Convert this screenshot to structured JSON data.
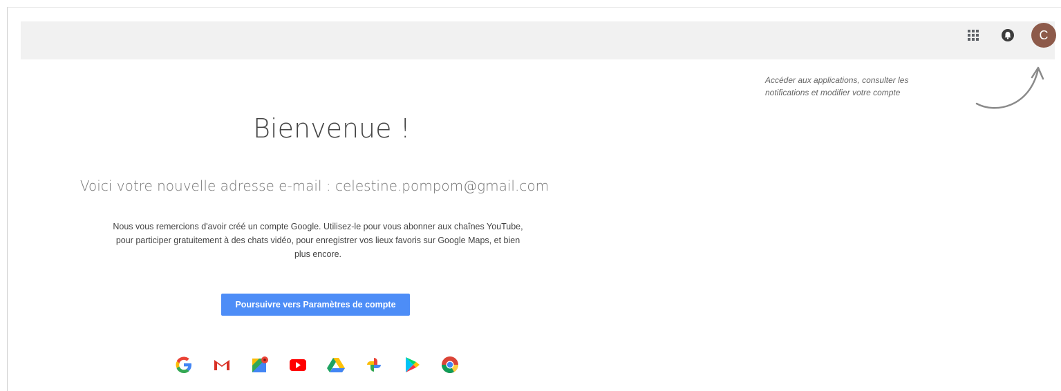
{
  "topbar": {
    "apps_icon": "apps-grid-icon",
    "notifications_icon": "notifications-bell-icon",
    "avatar_initial": "C",
    "avatar_color": "#8d5a4a"
  },
  "tooltip": {
    "line1": "Accéder aux applications, consulter les",
    "line2": "notifications et modifier votre compte"
  },
  "main": {
    "welcome": "Bienvenue !",
    "email_line": "Voici votre nouvelle adresse e-mail : celestine.pompom@gmail.com",
    "description_line1": "Nous vous remercions d'avoir créé un compte Google. Utilisez-le pour vous abonner aux chaînes YouTube,",
    "description_line2": "pour participer gratuitement à des chats vidéo, pour enregistrer vos lieux favoris sur Google Maps, et bien",
    "description_line3": "plus encore.",
    "cta_label": "Poursuivre vers Paramètres de compte",
    "cta_color": "#4d8df7"
  },
  "products": [
    {
      "name": "google-icon"
    },
    {
      "name": "gmail-icon"
    },
    {
      "name": "maps-icon"
    },
    {
      "name": "youtube-icon"
    },
    {
      "name": "drive-icon"
    },
    {
      "name": "photos-icon"
    },
    {
      "name": "play-icon"
    },
    {
      "name": "chrome-icon"
    }
  ]
}
